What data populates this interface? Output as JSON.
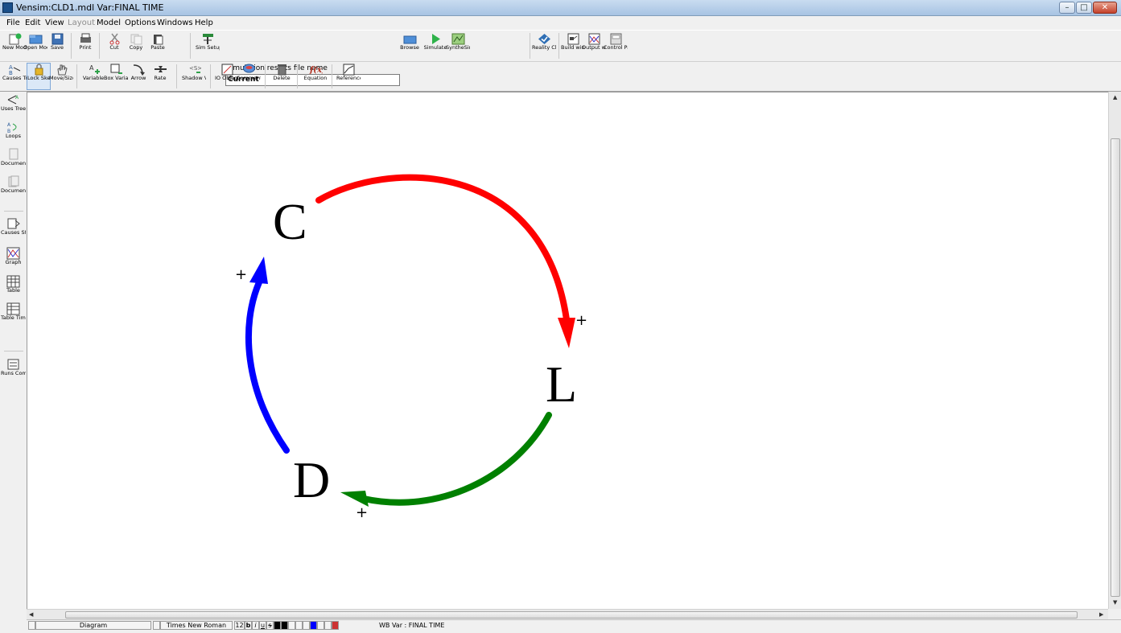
{
  "window": {
    "title": "Vensim:CLD1.mdl Var:FINAL TIME"
  },
  "menu": [
    "File",
    "Edit",
    "View",
    "Layout",
    "Model",
    "Options",
    "Windows",
    "Help"
  ],
  "toolbar1": {
    "new_model": "New Model",
    "open_model": "Open Model",
    "save": "Save",
    "print": "Print",
    "cut": "Cut",
    "copy": "Copy",
    "paste": "Paste",
    "sim_setup": "Sim Setup",
    "sim_results_label": "Simulation results file name",
    "sim_results_value": "Current",
    "browse": "Browse",
    "simulate": "Simulate",
    "synthesim": "SyntheSim",
    "reality_checks": "Reality Checks",
    "build_windows": "Build windows",
    "output_windows": "Output windows",
    "control_panel": "Control Panel"
  },
  "toolbar2": {
    "lock_sketch": "Lock Sketch",
    "move_size": "Move/Size",
    "variable": "Variable",
    "box_variable": "Box Variable",
    "arrow": "Arrow",
    "rate": "Rate",
    "shadow_variable": "Shadow Variable",
    "io_object": "IO Object",
    "comment": "Comment",
    "delete": "Delete",
    "equation": "Equation",
    "reference_mode": "Reference Mode"
  },
  "left_tools": {
    "causes_tree": "Causes Tree",
    "uses_tree": "Uses Tree",
    "loops": "Loops",
    "document": "Document",
    "document_all": "Document All",
    "causes_strip": "Causes Strip",
    "graph": "Graph",
    "table": "Table",
    "table_time": "Table Time",
    "runs_compare": "Runs Compare"
  },
  "diagram": {
    "variables": [
      "C",
      "L",
      "D"
    ],
    "polarity": [
      "+",
      "+",
      "+"
    ],
    "colors": {
      "c_to_l": "#ff0000",
      "l_to_d": "#008000",
      "d_to_c": "#0000ff"
    }
  },
  "status": {
    "view": "Diagram",
    "font": "Times New Roman",
    "font_size": "12",
    "styles": [
      "b",
      "i",
      "u",
      "s"
    ],
    "var_info": "WB Var : FINAL TIME"
  }
}
